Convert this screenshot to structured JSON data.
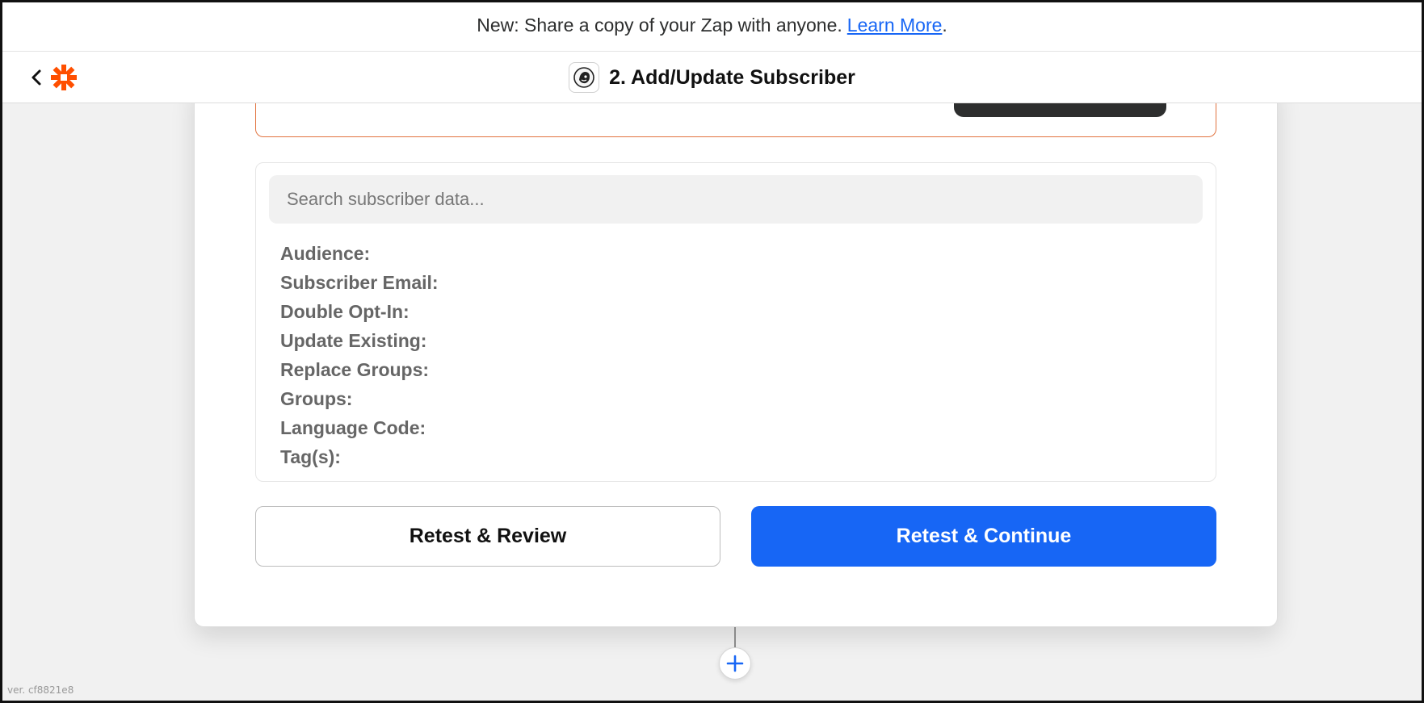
{
  "banner": {
    "text": "New: Share a copy of your Zap with anyone.",
    "link_label": "Learn More",
    "suffix": "."
  },
  "header": {
    "back_icon": "chevron-left-icon",
    "logo": "zapier-logo",
    "app_icon": "mailchimp-icon",
    "step_title": "2. Add/Update Subscriber"
  },
  "search": {
    "placeholder": "Search subscriber data..."
  },
  "fields": [
    "Audience:",
    "Subscriber Email:",
    "Double Opt-In:",
    "Update Existing:",
    "Replace Groups:",
    "Groups:",
    "Language Code:",
    "Tag(s):"
  ],
  "buttons": {
    "retest_review": "Retest & Review",
    "retest_continue": "Retest & Continue"
  },
  "footer": {
    "version": "ver. cf8821e8"
  },
  "colors": {
    "accent": "#1766f5",
    "brand": "#ff4f00",
    "alert_border": "#e2733f"
  }
}
